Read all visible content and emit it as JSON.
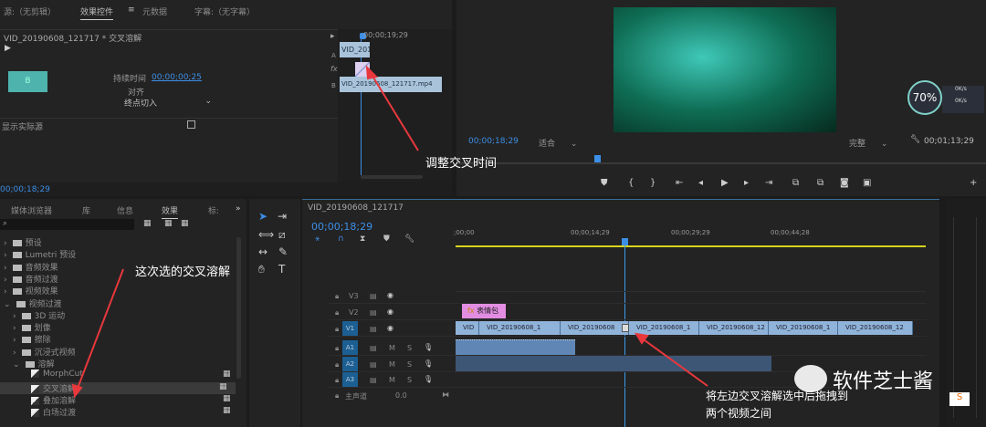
{
  "source_panel": {
    "tabs": [
      "源:（无剪辑）",
      "效果控件",
      "元数据",
      "字幕:（无字幕）"
    ],
    "menu_icon": "≡",
    "clip_title": "VID_20190608_121717 * 交叉溶解",
    "duration_label": "持续时间",
    "duration_value": "00;00;00;25",
    "align_label": "对齐",
    "align_value": "终点切入",
    "show_actual_label": "显示实际源",
    "timecode": "00;00;18;29",
    "mini_timeline": {
      "time": "00;00;19;29",
      "clip_a": "VID_201",
      "clip_b": "VID_20190608_121717.mp4",
      "track_a": "A",
      "track_fx": "fx",
      "track_b": "B"
    }
  },
  "program_monitor": {
    "timecode": "00;00;18;29",
    "fit": "适合",
    "quality": "完整",
    "duration": "00;01;13;29",
    "cpu_percent": "70%",
    "net_up": "0K/s",
    "net_down": "0K/s"
  },
  "effects_panel": {
    "tabs": [
      "媒体浏览器",
      "库",
      "信息",
      "效果",
      "标:"
    ],
    "more": "»",
    "items": [
      {
        "label": "预设",
        "level": 0
      },
      {
        "label": "Lumetri 预设",
        "level": 0
      },
      {
        "label": "音频效果",
        "level": 0
      },
      {
        "label": "音频过渡",
        "level": 0
      },
      {
        "label": "视频效果",
        "level": 0
      },
      {
        "label": "视频过渡",
        "level": 0,
        "open": true
      },
      {
        "label": "3D 运动",
        "level": 1
      },
      {
        "label": "划像",
        "level": 1
      },
      {
        "label": "擦除",
        "level": 1
      },
      {
        "label": "沉浸式视频",
        "level": 1
      },
      {
        "label": "溶解",
        "level": 1,
        "open": true
      },
      {
        "label": "MorphCut",
        "level": 2
      },
      {
        "label": "交叉溶解",
        "level": 2,
        "selected": true
      },
      {
        "label": "叠加溶解",
        "level": 2
      },
      {
        "label": "白场过渡",
        "level": 2
      }
    ]
  },
  "timeline": {
    "sequence": "VID_20190608_121717",
    "timecode": "00;00;18;29",
    "ruler": [
      ";00;00",
      "00;00;14;29",
      "00;00;29;29",
      "00;00;44;28"
    ],
    "tracks": [
      "V3",
      "V2",
      "V1",
      "A1",
      "A2",
      "A3"
    ],
    "master_label": "主声道",
    "master_value": "0.0",
    "v2_clip": "表情包",
    "v1_clips": [
      "VID",
      "VID_20190608_1",
      "VID_20190608",
      "VID_20190608_1",
      "VID_20190608_12",
      "VID_20190608_1",
      "VID_20190608_12"
    ]
  },
  "annotations": {
    "adjust": "调整交叉时间",
    "choose": "这次选的交叉溶解",
    "drag": "将左边交叉溶解选中后拖拽到",
    "drag2": "两个视频之间"
  },
  "watermark": "软件芝士酱",
  "colors": {
    "accent": "#3d8ee6",
    "arrow": "#e8383d",
    "playbar": "#d7d41c"
  }
}
